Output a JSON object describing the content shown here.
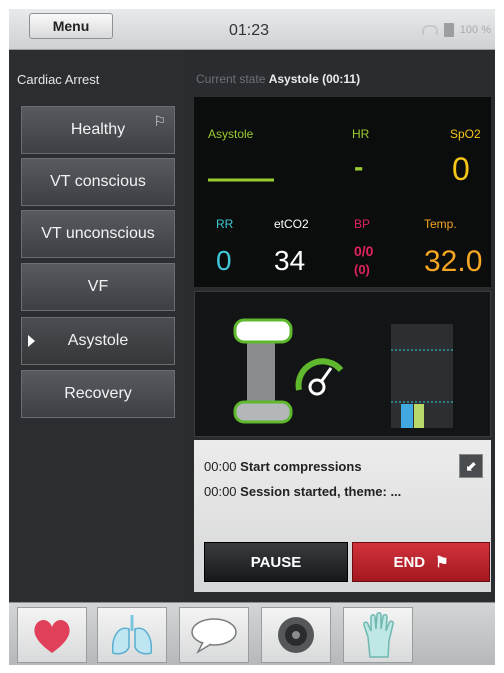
{
  "topbar": {
    "menu_label": "Menu",
    "clock": "01:23",
    "battery_text": "100 %",
    "icons": [
      "signal-icon",
      "battery-icon"
    ]
  },
  "sidebar": {
    "title": "Cardiac Arrest",
    "items": [
      {
        "label": "Healthy",
        "flag": true
      },
      {
        "label": "VT conscious"
      },
      {
        "label": "VT unconscious"
      },
      {
        "label": "VF"
      },
      {
        "label": "Asystole",
        "selected": true
      },
      {
        "label": "Recovery"
      }
    ]
  },
  "state": {
    "prefix": "Current state",
    "value": "Asystole (00:11)"
  },
  "vitals": {
    "rhythm": {
      "label": "Asystole",
      "color": "#9acd32"
    },
    "hr": {
      "label": "HR",
      "value": "-",
      "color": "#9acd32"
    },
    "spo2": {
      "label": "SpO2",
      "value": "0",
      "color": "#f5c518"
    },
    "rr": {
      "label": "RR",
      "value": "0",
      "color": "#3fc8d8"
    },
    "etco2": {
      "label": "etCO2",
      "value": "34",
      "color": "#ffffff"
    },
    "bp": {
      "label": "BP",
      "value": "0/0",
      "value2": "(0)",
      "color": "#e0245e"
    },
    "temp": {
      "label": "Temp.",
      "value": "32.0",
      "color": "#f5a623"
    }
  },
  "log": [
    {
      "time": "00:00",
      "text": "Start compressions"
    },
    {
      "time": "00:00",
      "text": "Session started, theme: ..."
    }
  ],
  "controls": {
    "pause_label": "PAUSE",
    "end_label": "END"
  },
  "toolbar": {
    "icons": [
      "heart-icon",
      "lungs-icon",
      "speech-bubble-icon",
      "speaker-icon",
      "glove-icon"
    ]
  }
}
